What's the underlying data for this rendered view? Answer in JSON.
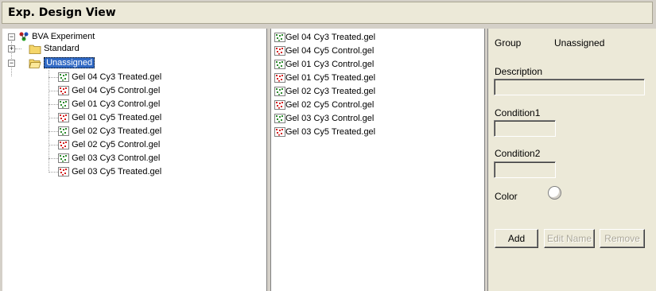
{
  "window": {
    "title": "Exp. Design View"
  },
  "tree": {
    "root": "BVA Experiment",
    "groups": [
      {
        "label": "Standard",
        "expanded": false
      },
      {
        "label": "Unassigned",
        "expanded": true,
        "selected": true
      }
    ],
    "items": [
      {
        "label": "Gel 04 Cy3 Treated.gel",
        "color": "green"
      },
      {
        "label": "Gel 04 Cy5 Control.gel",
        "color": "red"
      },
      {
        "label": "Gel 01 Cy3 Control.gel",
        "color": "green"
      },
      {
        "label": "Gel 01 Cy5 Treated.gel",
        "color": "red"
      },
      {
        "label": "Gel 02 Cy3 Treated.gel",
        "color": "green"
      },
      {
        "label": "Gel 02 Cy5 Control.gel",
        "color": "red"
      },
      {
        "label": "Gel 03 Cy3 Control.gel",
        "color": "green"
      },
      {
        "label": "Gel 03 Cy5 Treated.gel",
        "color": "red"
      }
    ]
  },
  "list": {
    "items": [
      {
        "label": "Gel 04 Cy3 Treated.gel",
        "color": "green"
      },
      {
        "label": "Gel 04 Cy5 Control.gel",
        "color": "red"
      },
      {
        "label": "Gel 01 Cy3 Control.gel",
        "color": "green"
      },
      {
        "label": "Gel 01 Cy5 Treated.gel",
        "color": "red"
      },
      {
        "label": "Gel 02 Cy3 Treated.gel",
        "color": "green"
      },
      {
        "label": "Gel 02 Cy5 Control.gel",
        "color": "red"
      },
      {
        "label": "Gel 03 Cy3 Control.gel",
        "color": "green"
      },
      {
        "label": "Gel 03 Cy5 Treated.gel",
        "color": "red"
      }
    ]
  },
  "props": {
    "group_label": "Group",
    "group_value": "Unassigned",
    "description_label": "Description",
    "description_value": "",
    "condition1_label": "Condition1",
    "condition1_value": "",
    "condition2_label": "Condition2",
    "condition2_value": "",
    "color_label": "Color",
    "add_button": "Add",
    "edit_name_button": "Edit Name",
    "remove_button": "Remove"
  },
  "colors": {
    "gel_green": "#2e8b2e",
    "gel_red": "#d42020",
    "selection": "#316ac5"
  }
}
